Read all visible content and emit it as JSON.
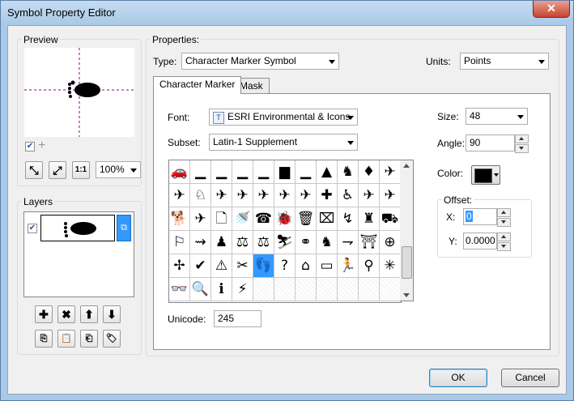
{
  "window": {
    "title": "Symbol Property Editor",
    "close_glyph": "✕"
  },
  "preview": {
    "label": "Preview",
    "zoom": "100%",
    "fixed_scale_label": "1:1"
  },
  "layers": {
    "label": "Layers",
    "lock_glyph": "⧉"
  },
  "properties": {
    "label": "Properties:",
    "type_label": "Type:",
    "type_value": "Character Marker Symbol",
    "units_label": "Units:",
    "units_value": "Points"
  },
  "tabs": [
    {
      "label": "Character Marker"
    },
    {
      "label": "Mask"
    }
  ],
  "marker": {
    "font_label": "Font:",
    "font_value": "ESRI Environmental & Icons",
    "font_icon_glyph": "T",
    "subset_label": "Subset:",
    "subset_value": "Latin-1 Supplement",
    "unicode_label": "Unicode:",
    "unicode_value": "245",
    "size_label": "Size:",
    "size_value": "48",
    "angle_label": "Angle:",
    "angle_value": "90",
    "color_label": "Color:",
    "color_value": "#000000",
    "offset_label": "Offset:",
    "x_label": "X:",
    "x_value": "0",
    "y_label": "Y:",
    "y_value": "0.0000"
  },
  "glyphs": [
    "🚗",
    "▁",
    "▁",
    "▁",
    "▁",
    "▆",
    "▁",
    "▲",
    "♞",
    "♦",
    "✈",
    "✈",
    "♘",
    "✈",
    "✈",
    "✈",
    "✈",
    "✈",
    "✚",
    "♿",
    "✈",
    "✈",
    "🐕",
    "✈",
    "🗋",
    "🚿",
    "☎",
    "🐞",
    "🗑",
    "⌧",
    "↯",
    "♜",
    "⛟",
    "⚐",
    "⇝",
    "♟",
    "⚖",
    "⚖",
    "⛷",
    "⚭",
    "♞",
    "⇁",
    "⛩",
    "⊕",
    "✢",
    "✔",
    "⚠",
    "✂",
    "👣",
    "?",
    "⌂",
    "▭",
    "🏃",
    "⚲",
    "✳",
    "👓",
    "🔍",
    "ℹ",
    "⚡",
    "",
    "",
    "",
    "",
    "",
    "",
    ""
  ],
  "selected_glyph_index": 48,
  "footer": {
    "ok_label": "OK",
    "cancel_label": "Cancel"
  },
  "layer_tools": {
    "add": "✚",
    "remove": "✖",
    "up": "⬆",
    "down": "⬇"
  }
}
